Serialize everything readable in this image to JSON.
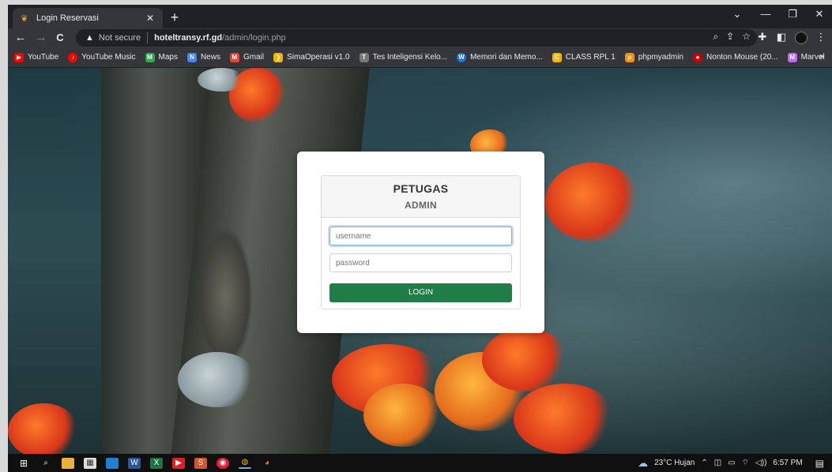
{
  "browser": {
    "tab": {
      "title": "Login Reservasi",
      "close": "✕"
    },
    "new_tab": "+",
    "window_controls": {
      "chevron": "⌄",
      "minimize": "—",
      "maximize": "❐",
      "close": "✕"
    },
    "nav": {
      "back": "←",
      "forward": "→",
      "reload": "C"
    },
    "address": {
      "warning": "Not secure",
      "host": "hoteltransy.rf.gd",
      "path": "/admin/login.php"
    },
    "bookmarks": [
      {
        "label": "YouTube",
        "color": "#ff0000",
        "glyph": "▶"
      },
      {
        "label": "YouTube Music",
        "color": "#ff0000",
        "glyph": "♪"
      },
      {
        "label": "Maps",
        "color": "#34a853",
        "glyph": "M"
      },
      {
        "label": "News",
        "color": "#4285f4",
        "glyph": "N"
      },
      {
        "label": "Gmail",
        "color": "#ea4335",
        "glyph": "M"
      },
      {
        "label": "SimaOperasi v1.0",
        "color": "#f4b400",
        "glyph": "❯"
      },
      {
        "label": "Tes Inteligensi Kelo...",
        "color": "#777777",
        "glyph": "T"
      },
      {
        "label": "Memori dan Memo...",
        "color": "#1a73e8",
        "glyph": "W"
      },
      {
        "label": "CLASS RPL 1",
        "color": "#f4b400",
        "glyph": "C"
      },
      {
        "label": "phpmyadmin",
        "color": "#f29111",
        "glyph": "p"
      },
      {
        "label": "Nonton Mouse (20...",
        "color": "#cc0000",
        "glyph": "●"
      },
      {
        "label": "Marvel",
        "color": "#c06cf0",
        "glyph": "M"
      }
    ],
    "bookmarks_more": "»"
  },
  "login": {
    "heading": "PETUGAS",
    "subheading": "ADMIN",
    "username_placeholder": "username",
    "password_placeholder": "password",
    "button_label": "LOGIN"
  },
  "taskbar": {
    "weather": "23°C Hujan",
    "time": "6:57 PM"
  }
}
